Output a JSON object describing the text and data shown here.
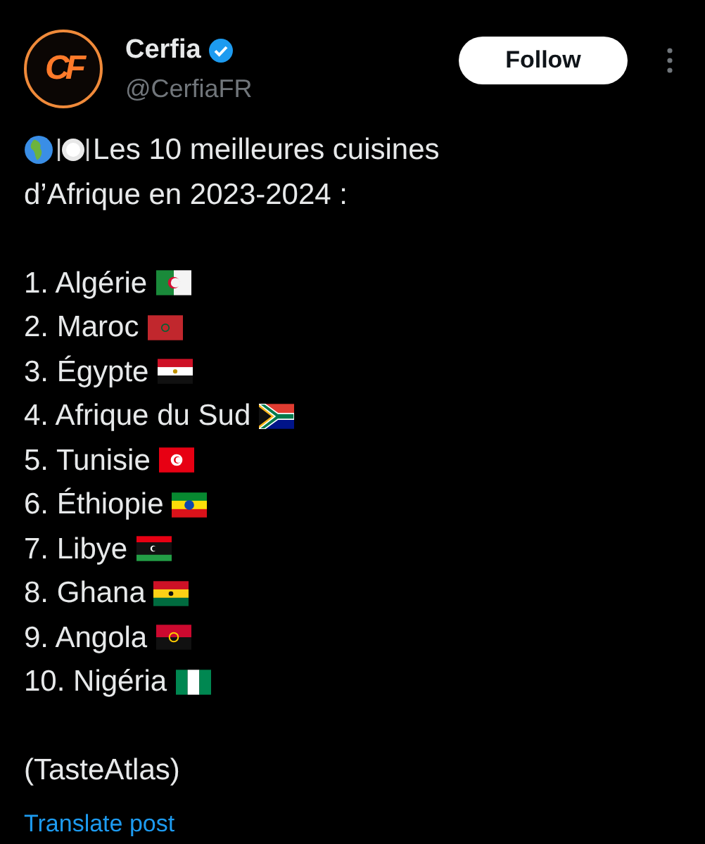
{
  "author": {
    "avatar_monogram": "CF",
    "name": "Cerfia",
    "verified": true,
    "handle": "@CerfiaFR"
  },
  "follow_button": "Follow",
  "post": {
    "intro_lines": [
      "Les 10 meilleures cuisines",
      "d’Afrique en 2023-2024 :"
    ],
    "ranking": [
      {
        "rank": "1.",
        "country": "Algérie"
      },
      {
        "rank": "2.",
        "country": "Maroc"
      },
      {
        "rank": "3.",
        "country": "Égypte"
      },
      {
        "rank": "4.",
        "country": "Afrique du Sud"
      },
      {
        "rank": "5.",
        "country": "Tunisie"
      },
      {
        "rank": "6.",
        "country": "Éthiopie"
      },
      {
        "rank": "7.",
        "country": "Libye"
      },
      {
        "rank": "8.",
        "country": "Ghana"
      },
      {
        "rank": "9.",
        "country": "Angola"
      },
      {
        "rank": "10.",
        "country": "Nigéria"
      }
    ],
    "source": "(TasteAtlas)"
  },
  "translate_link": "Translate post"
}
